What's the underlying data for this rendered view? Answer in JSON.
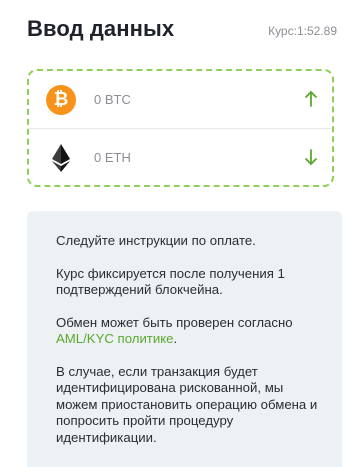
{
  "header": {
    "title": "Ввод данных",
    "rate_label": "Курс:",
    "rate_value": "1:52.89"
  },
  "exchange": {
    "send": {
      "currency": "BTC",
      "amount": "0 BTC",
      "icon": "bitcoin-icon",
      "icon_glyph": "₿",
      "direction_icon": "arrow-up-icon"
    },
    "receive": {
      "currency": "ETH",
      "amount": "0 ETH",
      "icon": "ethereum-icon",
      "direction_icon": "arrow-down-icon"
    }
  },
  "info": {
    "line1": "Следуйте инструкции по оплате.",
    "line2": "Курс фиксируется после получения 1 подтверждений блокчейна.",
    "line3_prefix": "Обмен может быть проверен согласно ",
    "line3_link": "AML/KYC политике",
    "line3_suffix": ".",
    "line4": "В случае, если транзакция будет идентифицирована рискованной, мы можем приостановить операцию обмена и попросить пройти процедуру идентификации."
  },
  "colors": {
    "accent_green": "#8fd05a",
    "link_green": "#5aa92e",
    "bitcoin_orange": "#f7931a",
    "card_background": "#edf1f4"
  }
}
